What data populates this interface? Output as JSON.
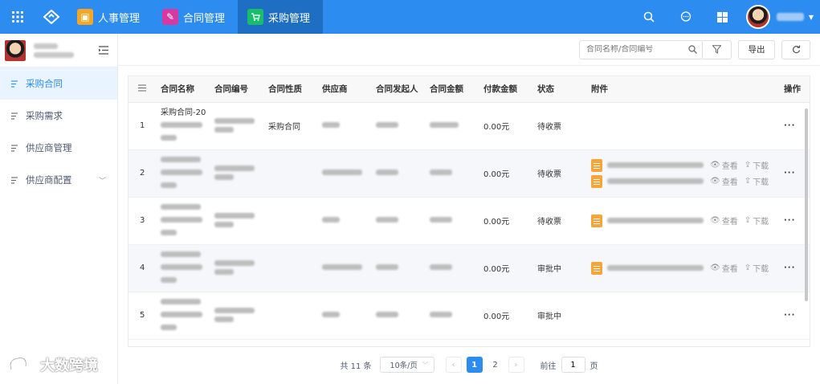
{
  "topbar": {
    "tabs": [
      {
        "label": "人事管理",
        "icon": "person-badge-icon",
        "color": "#f5a623"
      },
      {
        "label": "合同管理",
        "icon": "contract-icon",
        "color": "#d63aa2"
      },
      {
        "label": "采购管理",
        "icon": "cart-icon",
        "color": "#19be6b"
      }
    ],
    "active_tab": 2,
    "brand_color": "#2d8cf0"
  },
  "sidebar": {
    "items": [
      {
        "label": "采购合同",
        "active": true
      },
      {
        "label": "采购需求"
      },
      {
        "label": "供应商管理"
      },
      {
        "label": "供应商配置",
        "expandable": true
      }
    ]
  },
  "toolbar": {
    "search_placeholder": "合同名称/合同编号",
    "export_label": "导出"
  },
  "table": {
    "headers": [
      "合同名称",
      "合同编号",
      "合同性质",
      "供应商",
      "合同发起人",
      "合同金额",
      "付款金额",
      "状态",
      "附件",
      "操作"
    ],
    "view_label": "查看",
    "download_label": "下载",
    "more_label": "···",
    "rows": [
      {
        "index": "1",
        "name": "采购合同-20",
        "nature": "采购合同",
        "paid": "0.00元",
        "status": "待收票",
        "attachments": 0
      },
      {
        "index": "2",
        "paid": "0.00元",
        "status": "待收票",
        "attachments": 2
      },
      {
        "index": "3",
        "paid": "0.00元",
        "status": "待收票",
        "attachments": 1
      },
      {
        "index": "4",
        "paid": "0.00元",
        "status": "审批中",
        "attachments": 1
      },
      {
        "index": "5",
        "paid": "0.00元",
        "status": "审批中",
        "attachments": 0
      }
    ]
  },
  "pager": {
    "total": "共 11 条",
    "page_size": "10条/页",
    "pages": [
      "1",
      "2"
    ],
    "current": "1",
    "jump_prefix": "前往",
    "jump_value": "1",
    "jump_suffix": "页"
  },
  "watermark": {
    "text": "大数跨境"
  }
}
